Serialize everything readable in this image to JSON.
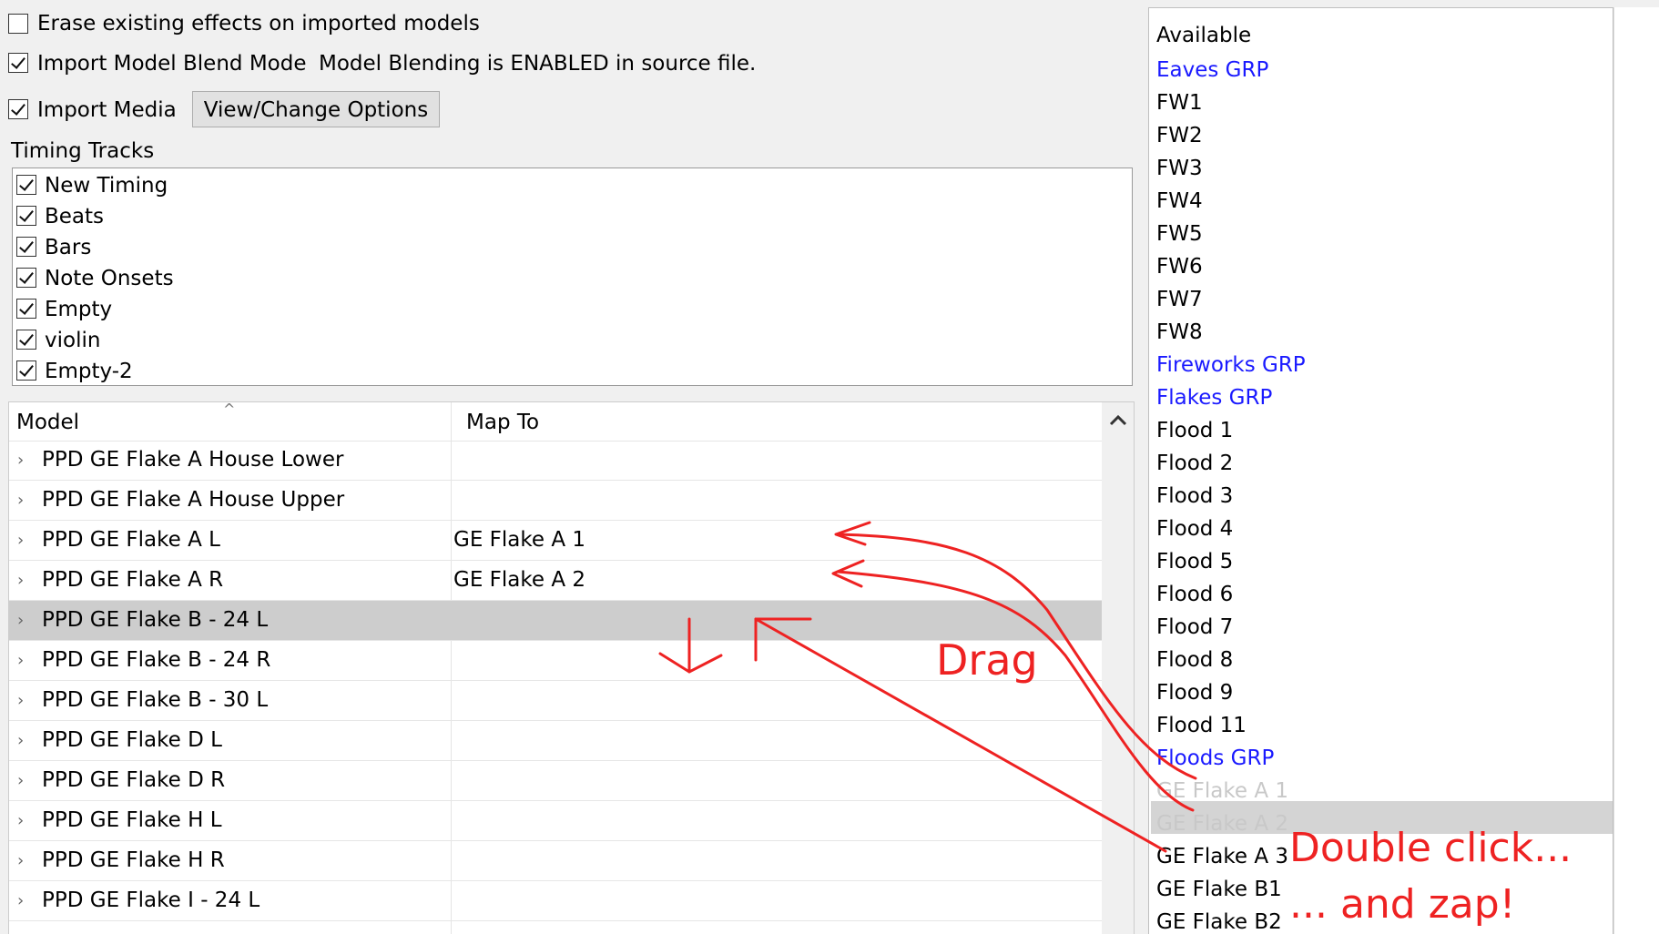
{
  "options": {
    "erase_label": "Erase existing effects on imported models",
    "blend_label": "Import Model Blend Mode",
    "blend_status": "Model Blending is ENABLED in source file.",
    "media_label": "Import Media",
    "view_change_button": "View/Change Options",
    "erase_checked": false,
    "blend_checked": true,
    "media_checked": true
  },
  "timing": {
    "title": "Timing Tracks",
    "tracks": [
      "New Timing",
      "Beats",
      "Bars",
      "Note Onsets",
      "Empty",
      "violin",
      "Empty-2"
    ]
  },
  "grid": {
    "col_model": "Model",
    "col_map": "Map To",
    "rows": [
      {
        "model": "PPD GE Flake A House Lower",
        "map": ""
      },
      {
        "model": "PPD GE Flake A House Upper",
        "map": ""
      },
      {
        "model": "PPD GE Flake A L",
        "map": "GE Flake A 1"
      },
      {
        "model": "PPD GE Flake A R",
        "map": "GE Flake A 2"
      },
      {
        "model": "PPD GE Flake B - 24 L",
        "map": ""
      },
      {
        "model": "PPD GE Flake B - 24 R",
        "map": ""
      },
      {
        "model": "PPD GE Flake B - 30 L",
        "map": ""
      },
      {
        "model": "PPD GE Flake D L",
        "map": ""
      },
      {
        "model": "PPD GE Flake D R",
        "map": ""
      },
      {
        "model": "PPD GE Flake H L",
        "map": ""
      },
      {
        "model": "PPD GE Flake H R",
        "map": ""
      },
      {
        "model": "PPD GE Flake I - 24 L",
        "map": ""
      }
    ],
    "selected_row": 4
  },
  "available": {
    "header": "Available",
    "items": [
      {
        "label": "Eaves GRP",
        "kind": "group"
      },
      {
        "label": "FW1",
        "kind": "model"
      },
      {
        "label": "FW2",
        "kind": "model"
      },
      {
        "label": "FW3",
        "kind": "model"
      },
      {
        "label": "FW4",
        "kind": "model"
      },
      {
        "label": "FW5",
        "kind": "model"
      },
      {
        "label": "FW6",
        "kind": "model"
      },
      {
        "label": "FW7",
        "kind": "model"
      },
      {
        "label": "FW8",
        "kind": "model"
      },
      {
        "label": "Fireworks GRP",
        "kind": "group"
      },
      {
        "label": "Flakes GRP",
        "kind": "group"
      },
      {
        "label": "Flood 1",
        "kind": "model"
      },
      {
        "label": "Flood 2",
        "kind": "model"
      },
      {
        "label": "Flood 3",
        "kind": "model"
      },
      {
        "label": "Flood 4",
        "kind": "model"
      },
      {
        "label": "Flood 5",
        "kind": "model"
      },
      {
        "label": "Flood 6",
        "kind": "model"
      },
      {
        "label": "Flood 7",
        "kind": "model"
      },
      {
        "label": "Flood 8",
        "kind": "model"
      },
      {
        "label": "Flood 9",
        "kind": "model"
      },
      {
        "label": "Flood 11",
        "kind": "model"
      },
      {
        "label": "Floods GRP",
        "kind": "group"
      },
      {
        "label": "GE Flake A 1",
        "kind": "used"
      },
      {
        "label": "GE Flake A 2",
        "kind": "used"
      },
      {
        "label": "GE Flake A 3",
        "kind": "model"
      },
      {
        "label": "GE Flake B1",
        "kind": "model"
      },
      {
        "label": "GE Flake B2",
        "kind": "model"
      }
    ],
    "highlighted_index": 23
  },
  "annotations": {
    "drag": "Drag",
    "double_click": "Double click...",
    "zap": "... and zap!"
  },
  "colors": {
    "group_link": "#1a1aff",
    "annotation_red": "#ee2222",
    "selected_row": "#cdcdcd"
  }
}
